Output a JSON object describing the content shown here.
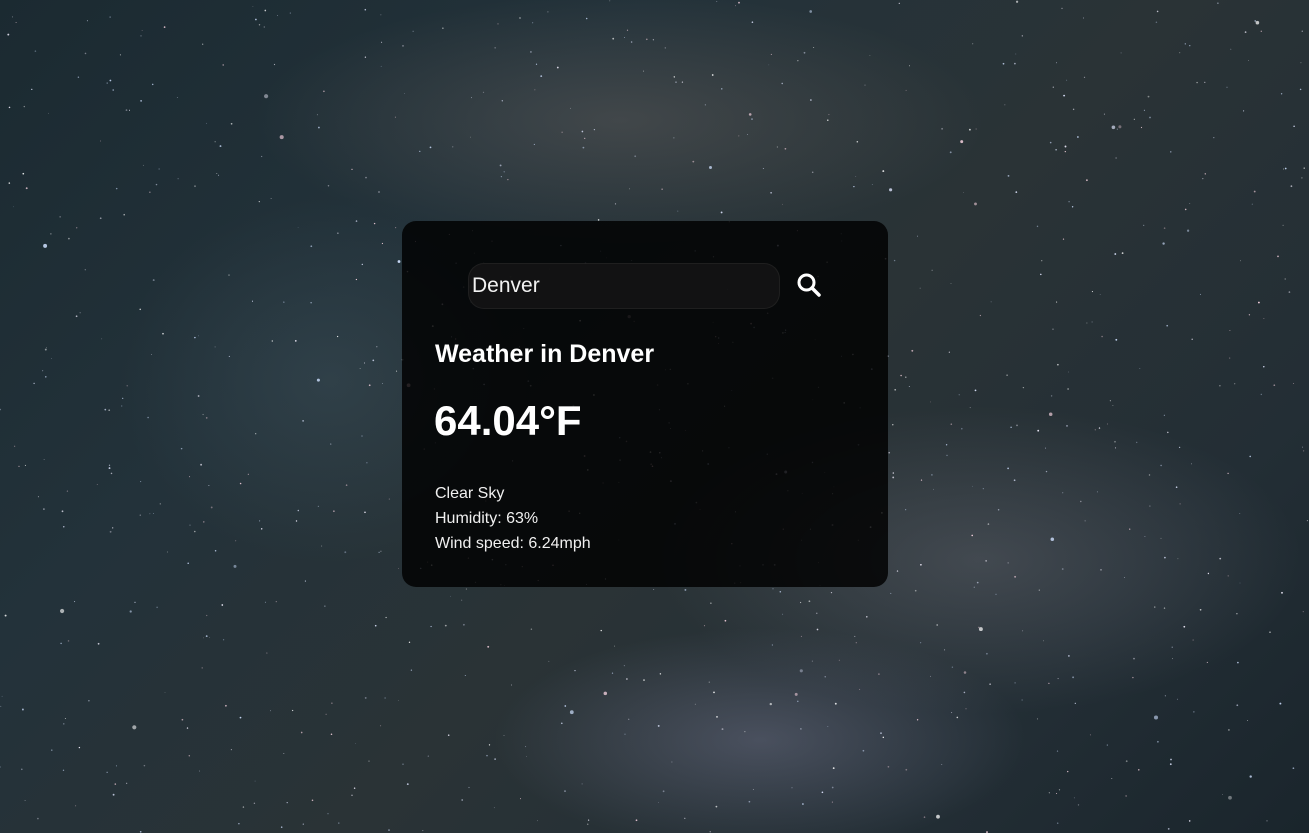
{
  "search": {
    "value": "Denver",
    "button_icon": "search-icon"
  },
  "weather": {
    "title": "Weather in Denver",
    "temperature": "64.04°F",
    "description": "Clear Sky",
    "humidity": "Humidity: 63%",
    "wind": "Wind speed: 6.24mph"
  }
}
